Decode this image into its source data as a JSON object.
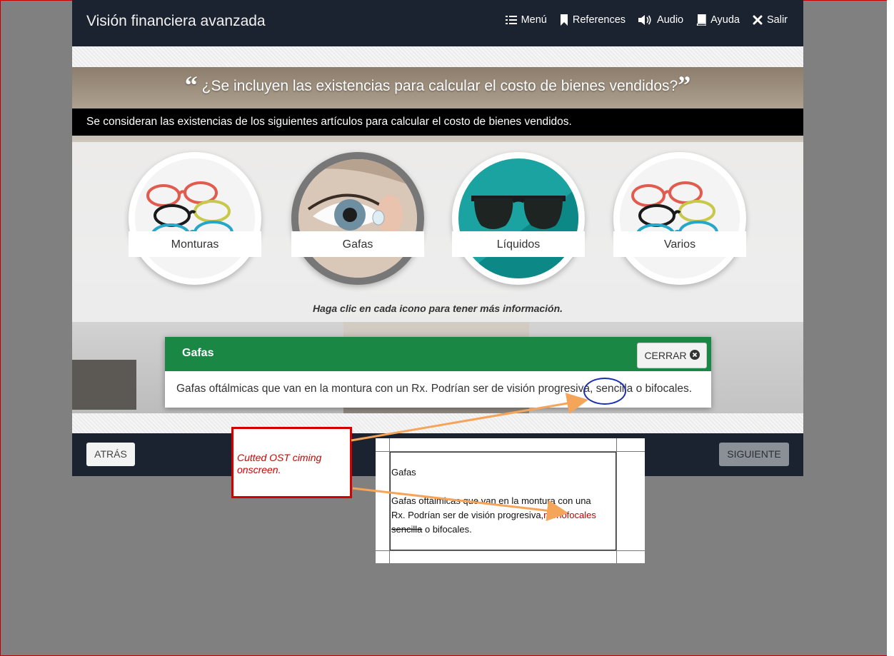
{
  "header": {
    "title": "Visión financiera avanzada",
    "nav": [
      {
        "label": "Menú",
        "icon": "list-icon"
      },
      {
        "label": "References",
        "icon": "bookmark-icon"
      },
      {
        "label": "Audio",
        "icon": "speaker-icon"
      },
      {
        "label": "Ayuda",
        "icon": "book-icon"
      },
      {
        "label": "Salir",
        "icon": "close-icon"
      }
    ]
  },
  "question": {
    "open_quote": "“",
    "text": "¿Se incluyen las existencias para calcular el costo de bienes vendidos?",
    "close_quote": "”"
  },
  "subtitle": "Se consideran las existencias de los siguientes artículos para calcular el costo de bienes vendidos.",
  "icons": [
    {
      "label": "Monturas",
      "image": "eyeglass-frames",
      "selected": false
    },
    {
      "label": "Gafas",
      "image": "contact-lens-eye",
      "selected": true
    },
    {
      "label": "Líquidos",
      "image": "sunglasses",
      "selected": false
    },
    {
      "label": "Varios",
      "image": "eyeglass-frames",
      "selected": false
    }
  ],
  "hint": "Haga clic en cada icono para tener más información.",
  "popup": {
    "title": "Gafas",
    "close_label": "CERRAR",
    "body_before": "Gafas oftálmicas que van en la montura con un Rx. Podrían ser de visión progresiva,",
    "body_highlight": "sencilla",
    "body_after": "o bifocales."
  },
  "footer": {
    "back_label": "ATRÁS",
    "next_label": "SIGUIENTE"
  },
  "annotation": {
    "note": "Cutted OST ciming onscreen.",
    "doc_title": "Gafas",
    "doc_line1": "Gafas oftálmicas que van en la montura con una",
    "doc_line2_before": "Rx. Podrían ser de visión progresiva,",
    "doc_line2_inserted": "monofocales",
    "doc_line3_struck": "sencilla",
    "doc_line3_after": " o bifocales."
  },
  "colors": {
    "topbar": "#1b2230",
    "popup_header": "#1a8745",
    "annotation_red": "#d40000",
    "annotation_arrow": "#f5a55a",
    "annotation_circle": "#1a2fb0"
  }
}
